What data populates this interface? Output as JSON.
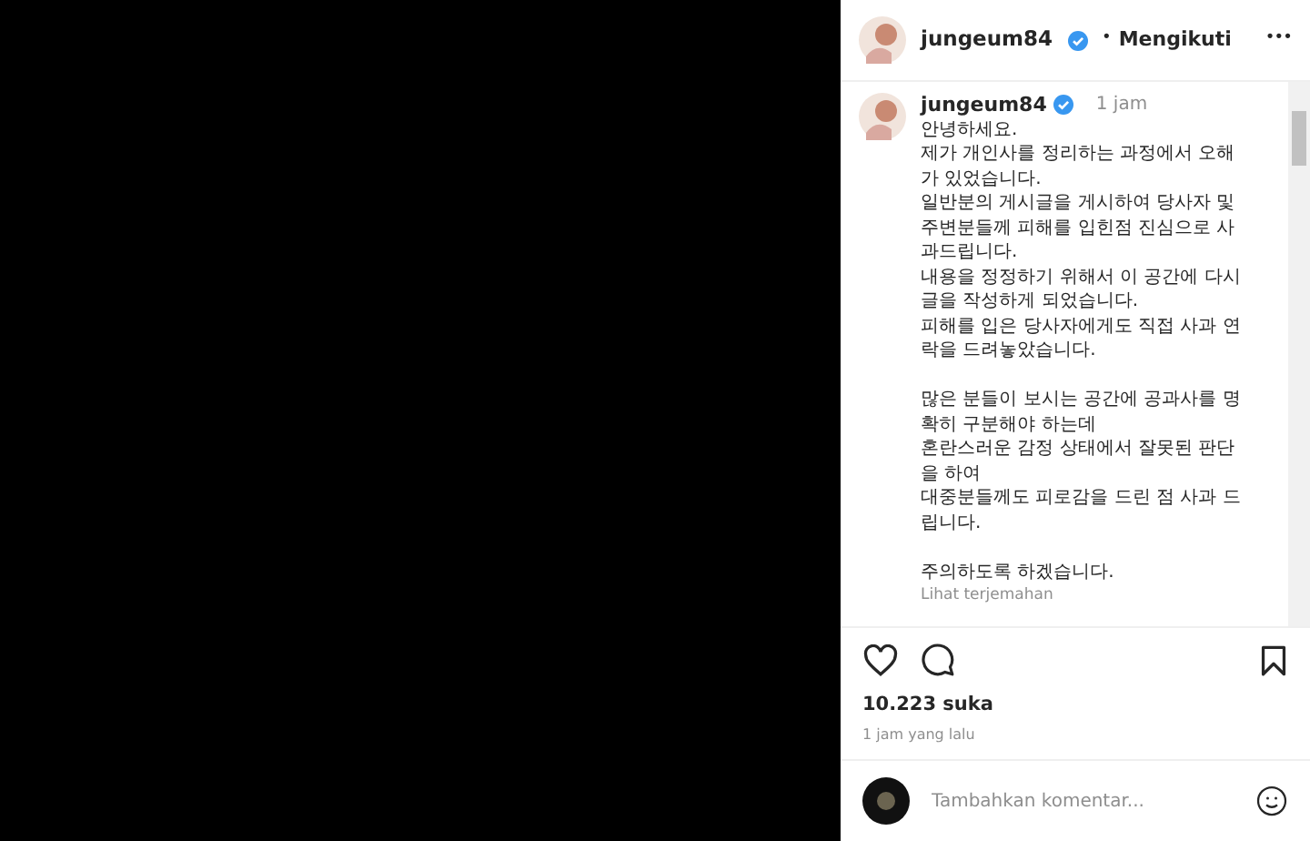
{
  "header": {
    "username": "jungeum84",
    "separator": "•",
    "follow": "Mengikuti",
    "more": "•••"
  },
  "caption": {
    "username": "jungeum84",
    "time": "1 jam",
    "paragraphs": [
      [
        "안녕하세요.",
        "제가 개인사를 정리하는 과정에서 오해",
        "가 있었습니다.",
        "일반분의 게시글을 게시하여 당사자 및",
        "주변분들께 피해를 입힌점 진심으로 사",
        "과드립니다.",
        "내용을 정정하기 위해서 이 공간에 다시",
        "글을 작성하게 되었습니다.",
        "피해를 입은 당사자에게도 직접 사과 연",
        "락을 드려놓았습니다."
      ],
      [
        "많은 분들이 보시는 공간에 공과사를 명",
        "확히 구분해야 하는데",
        "혼란스러운 감정 상태에서 잘못된 판단",
        "을 하여",
        "대중분들께도 피로감을 드린 점 사과 드",
        "립니다."
      ],
      [
        "주의하도록 하겠습니다."
      ]
    ],
    "translate": "Lihat terjemahan"
  },
  "likes": "10.223 suka",
  "posted": "1 jam yang lalu",
  "comment": {
    "placeholder": "Tambahkan komentar..."
  }
}
